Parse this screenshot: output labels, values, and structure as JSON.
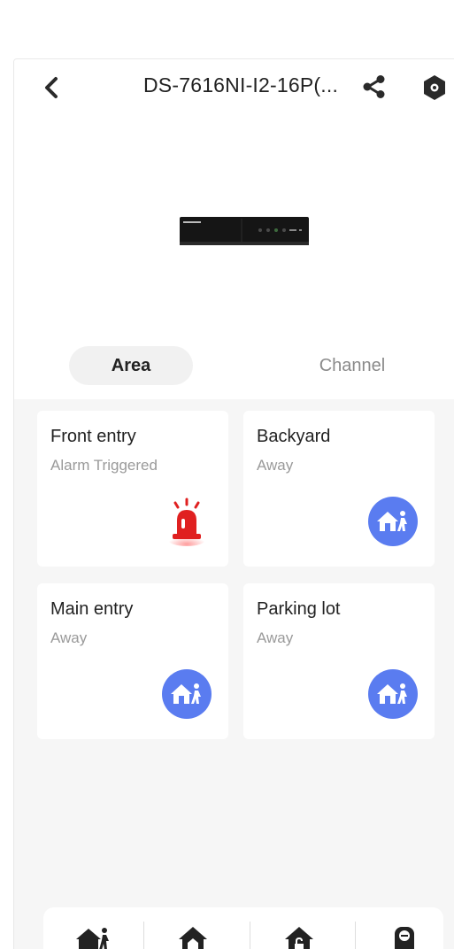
{
  "header": {
    "title": "DS-7616NI-I2-16P(..."
  },
  "tabs": [
    {
      "label": "Area",
      "selected": true
    },
    {
      "label": "Channel",
      "selected": false
    }
  ],
  "areas": [
    {
      "name": "Front entry",
      "status": "Alarm Triggered",
      "icon": "alarm-siren-icon"
    },
    {
      "name": "Backyard",
      "status": "Away",
      "icon": "away-arm-icon"
    },
    {
      "name": "Main entry",
      "status": "Away",
      "icon": "away-arm-icon"
    },
    {
      "name": "Parking lot",
      "status": "Away",
      "icon": "away-arm-icon"
    }
  ],
  "bottom_actions": [
    "away-arm-icon",
    "stay-arm-icon",
    "disarm-icon",
    "clear-alarm-icon"
  ],
  "colors": {
    "accent": "#5a7cf0",
    "alarm": "#e02020",
    "background": "#f6f6f6"
  }
}
